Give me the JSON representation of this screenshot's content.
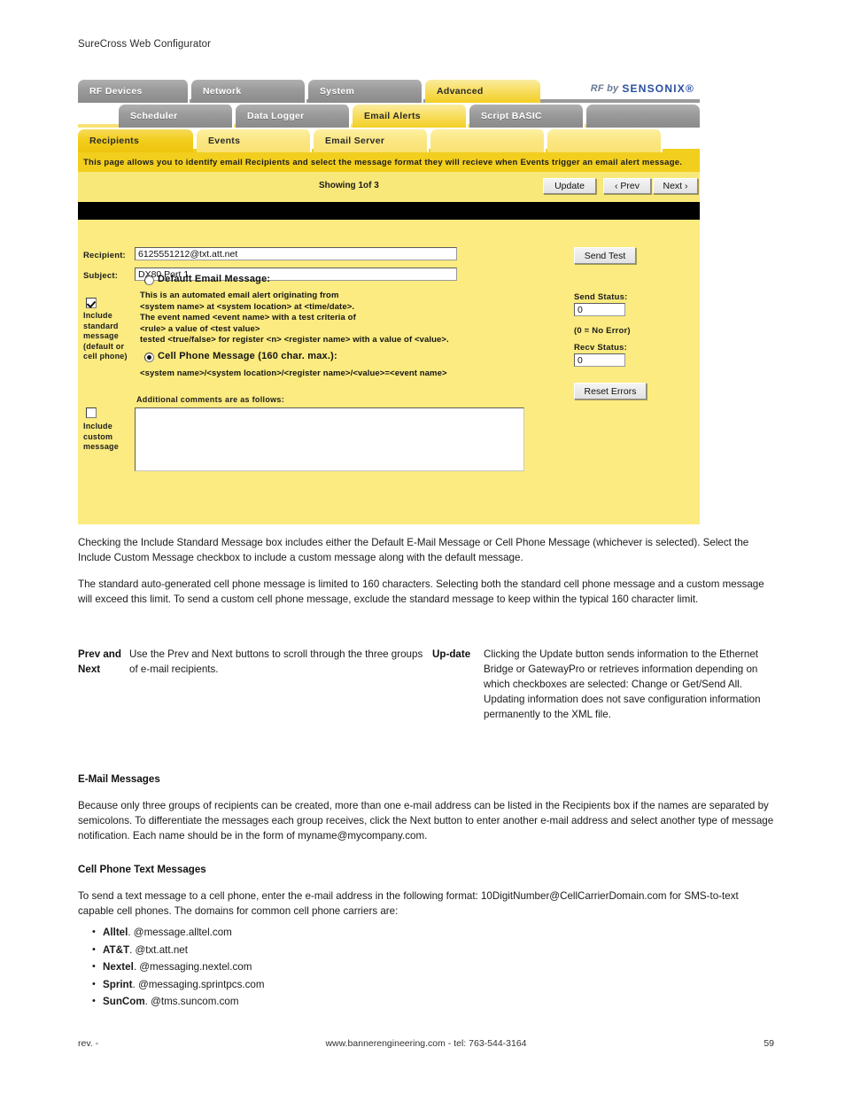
{
  "document": {
    "title": "SureCross Web Configurator",
    "paragraphs": {
      "p1": "Checking the Include Standard Message box includes either the Default E-Mail Message or Cell Phone Message (whichever is selected). Select the Include Custom Message checkbox to include a custom message along with the default message.",
      "p2": "The standard auto-generated cell phone message is limited to 160 characters. Selecting both the standard cell phone message and a custom message will exceed this limit. To send a custom cell phone message, exclude the standard message to keep within the typical 160 character limit.",
      "p3": "Because only three groups of recipients can be created, more than one e-mail address can be listed in the Recipients box if the names are separated by semicolons. To differentiate the messages each group receives, click the Next button to enter another e-mail address and select another type of message notification. Each name should be in the form of myname@mycompany.com.",
      "p4": "To send a text message to a cell phone, enter the e-mail address in the following format: 10DigitNumber@CellCarrierDomain.com for SMS-to-text capable cell phones. The domains for common cell phone carriers are:"
    },
    "definitions": [
      {
        "term": "Prev and Next",
        "description": "Use the Prev and Next buttons to scroll through the three groups of e-mail recipients."
      },
      {
        "term": "Up-date",
        "description": "Clicking the Update button sends information to the Ethernet Bridge or GatewayPro or retrieves information depending on which checkboxes are selected: Change or Get/Send All. Updating information does not save configuration information permanently to the XML file."
      }
    ],
    "headings": {
      "email_messages": "E-Mail Messages",
      "cell_phone_text_messages": "Cell Phone Text Messages"
    },
    "carriers": [
      {
        "name": "Alltel",
        "domain": ". @message.alltel.com"
      },
      {
        "name": "AT&T",
        "domain": ". @txt.att.net"
      },
      {
        "name": "Nextel",
        "domain": ". @messaging.nextel.com"
      },
      {
        "name": "Sprint",
        "domain": ". @messaging.sprintpcs.com"
      },
      {
        "name": "SunCom",
        "domain": ". @tms.suncom.com"
      }
    ],
    "footer": {
      "left": "rev. -",
      "center": "www.bannerengineering.com - tel: 763-544-3164",
      "right": "59"
    }
  },
  "app": {
    "logo": {
      "prefix": "RF by",
      "mark": "SENSONIX®"
    },
    "tabs_row1": [
      {
        "label": "RF Devices",
        "state": "inactive"
      },
      {
        "label": "Network",
        "state": "inactive"
      },
      {
        "label": "System",
        "state": "inactive"
      },
      {
        "label": "Advanced",
        "state": "active"
      }
    ],
    "tabs_row2": [
      {
        "label": "Scheduler",
        "state": "inactive"
      },
      {
        "label": "Data Logger",
        "state": "inactive"
      },
      {
        "label": "Email Alerts",
        "state": "active"
      },
      {
        "label": "Script BASIC",
        "state": "inactive"
      },
      {
        "label": "",
        "state": "inactive"
      }
    ],
    "tabs_row3": [
      {
        "label": "Recipients",
        "state": "active"
      },
      {
        "label": "Events",
        "state": "inactive"
      },
      {
        "label": "Email Server",
        "state": "inactive"
      },
      {
        "label": "",
        "state": "inactive"
      },
      {
        "label": "",
        "state": "inactive"
      }
    ],
    "banner": "This page allows you to identify email Recipients and select the message format they will recieve when Events trigger an email alert message.",
    "toolbar": {
      "showing": "Showing 1of 3",
      "update_label": "Update",
      "prev_label": "‹ Prev",
      "next_label": "Next ›"
    },
    "form": {
      "recipient_label": "Recipient:",
      "recipient_value": "6125551212@txt.att.net",
      "subject_label": "Subject:",
      "subject_value": "DX80 Port 1",
      "include_standard_label": "Include standard message (default or cell phone)",
      "include_standard_checked": true,
      "include_custom_label": "Include custom message",
      "include_custom_checked": false,
      "default_email_radio_label": "Default Email Message:",
      "default_email_selected": false,
      "default_email_body": "This is an automated email alert originating from\n<system name> at <system location> at <time/date>.\nThe event named <event name> with a test criteria of\n<rule> a value of <test value>\ntested <true/false> for register <n> <register name> with a value of <value>.",
      "cell_phone_radio_label": "Cell Phone Message (160 char. max.):",
      "cell_phone_selected": true,
      "cell_phone_body": "<system name>/<system location>/<register name>/<value>=<event name>",
      "comments_label": "Additional comments are as follows:",
      "comments_value": ""
    },
    "status": {
      "send_test_label": "Send Test",
      "send_status_label": "Send Status:",
      "send_status_value": "0",
      "no_error_note": "(0 = No Error)",
      "recv_status_label": "Recv Status:",
      "recv_status_value": "0",
      "reset_errors_label": "Reset Errors"
    }
  },
  "colors": {
    "panel_yellow": "#fbeb80",
    "banner_gold": "#f2ce1e",
    "tab_gray": "#9a9a9a",
    "tab_light_yellow": "#f9e173",
    "logo_blue": "#2a4f9e"
  }
}
